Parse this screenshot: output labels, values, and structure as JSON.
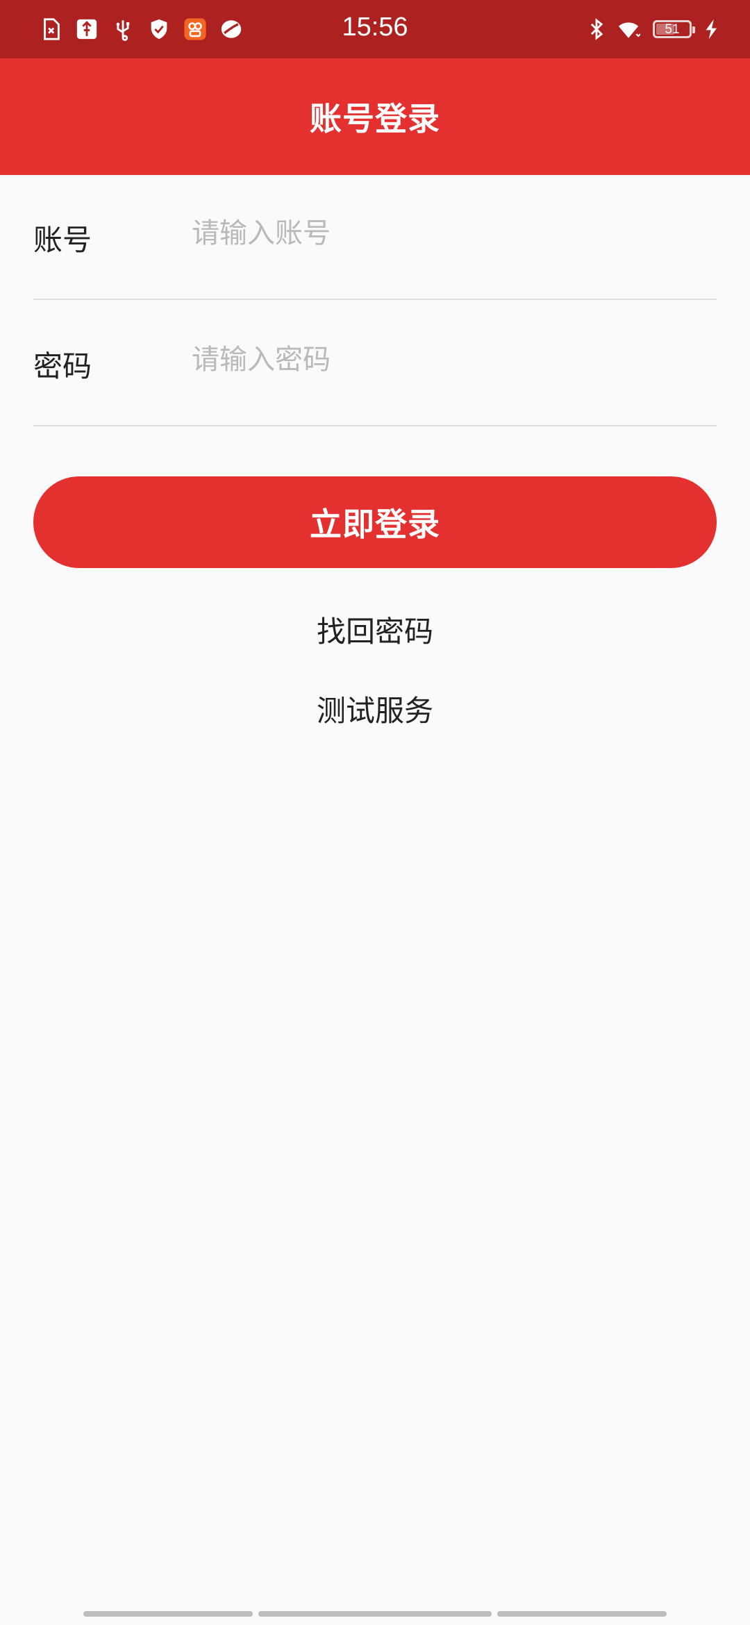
{
  "status_bar": {
    "time": "15:56",
    "battery_level": "51",
    "left_icons": [
      "sim-error-icon",
      "usb-debug-icon",
      "usb-icon",
      "shield-icon",
      "app-notification-icon",
      "sync-icon"
    ],
    "right_icons": [
      "bluetooth-icon",
      "wifi-icon",
      "battery-icon",
      "charging-icon"
    ]
  },
  "header": {
    "title": "账号登录"
  },
  "form": {
    "account_label": "账号",
    "account_placeholder": "请输入账号",
    "password_label": "密码",
    "password_placeholder": "请输入密码"
  },
  "actions": {
    "login_label": "立即登录",
    "forgot_password_label": "找回密码",
    "test_service_label": "测试服务"
  },
  "colors": {
    "status_bar": "#ae2121",
    "primary": "#e53030",
    "background": "#fafafa"
  }
}
